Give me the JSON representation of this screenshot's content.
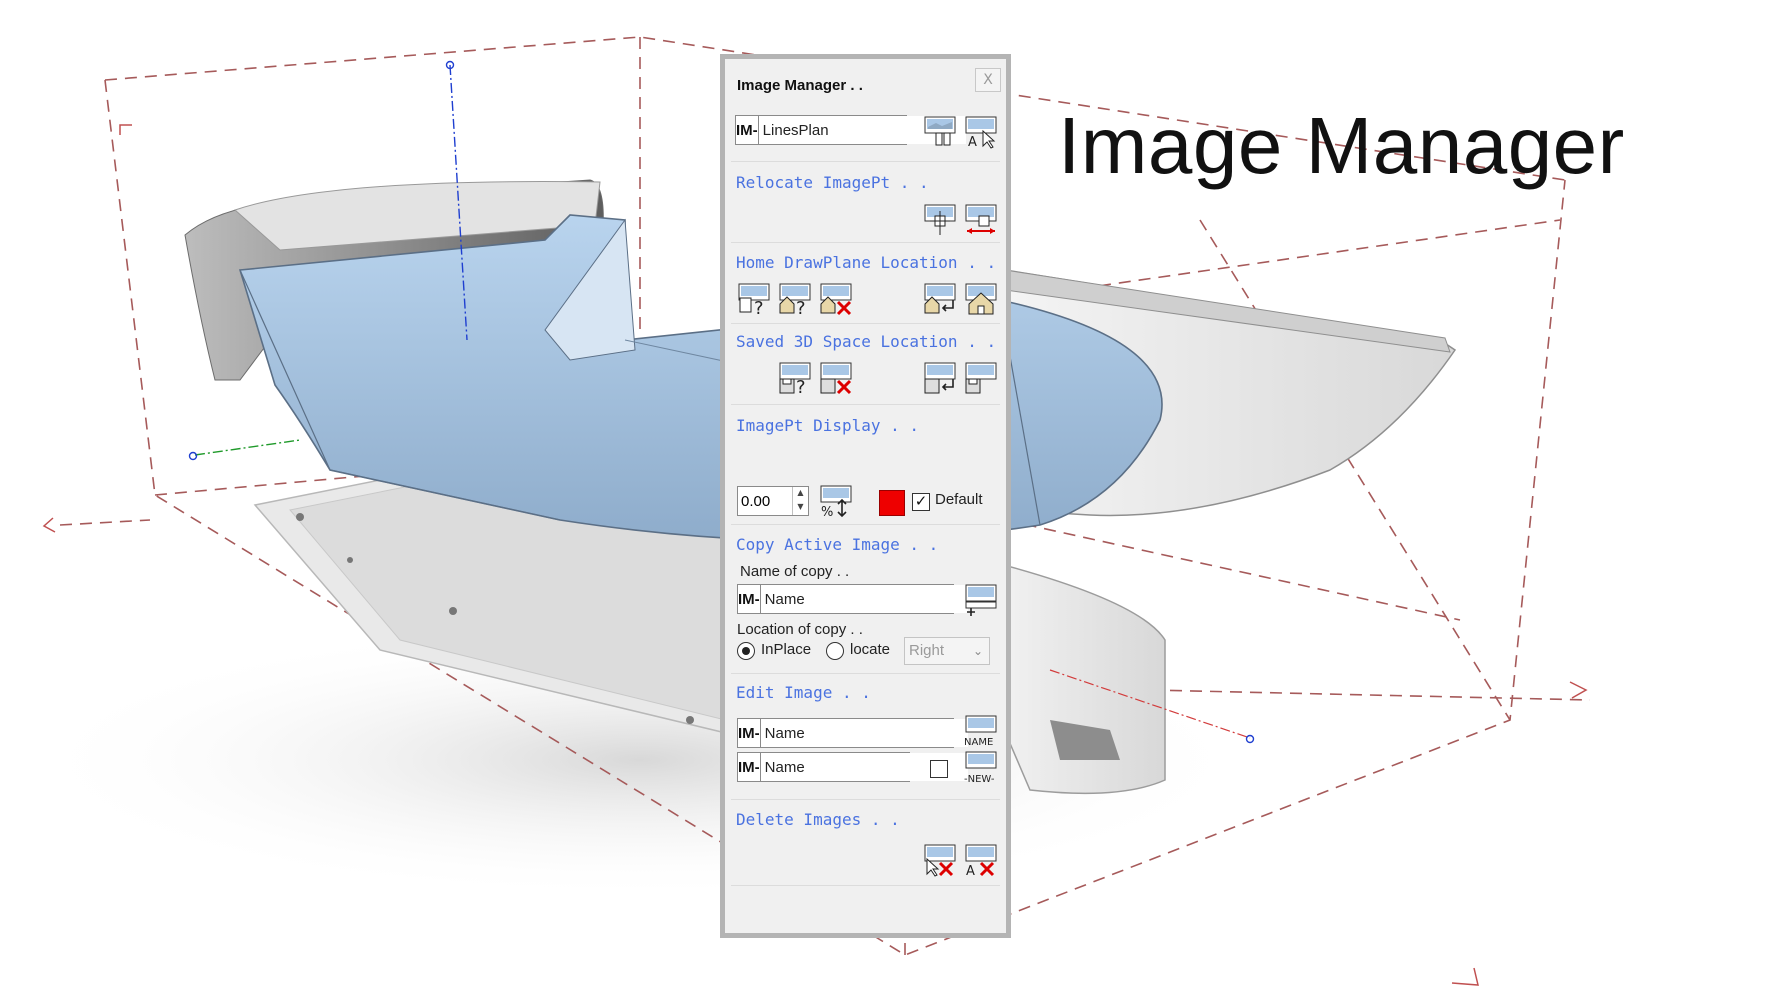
{
  "overlay_title": "Image Manager",
  "panel": {
    "title": "Image Manager . .",
    "close_label": "X",
    "im_prefix": "IM-",
    "active_image": {
      "value": "LinesPlan"
    },
    "sections": {
      "relocate": "Relocate ImagePt . .",
      "home": "Home DrawPlane Location . .",
      "saved3d": "Saved 3D Space Location . .",
      "display": "ImagePt Display . .",
      "copy": "Copy Active Image . .",
      "edit": "Edit Image . .",
      "delete": "Delete Images . ."
    },
    "display": {
      "size_value": "0.00",
      "swatch_color": "#ee0000",
      "default_label": "Default",
      "default_checked": true
    },
    "copy": {
      "name_label": "Name of copy . .",
      "name_value": "Name",
      "location_label": "Location of copy . .",
      "option_inplace": "InPlace",
      "option_locate": "locate",
      "selected": "InPlace",
      "direction_value": "Right"
    },
    "edit": {
      "rename_value": "Name",
      "new_value": "Name",
      "name_button_label": "NAME",
      "new_button_label": "-NEW-"
    }
  }
}
